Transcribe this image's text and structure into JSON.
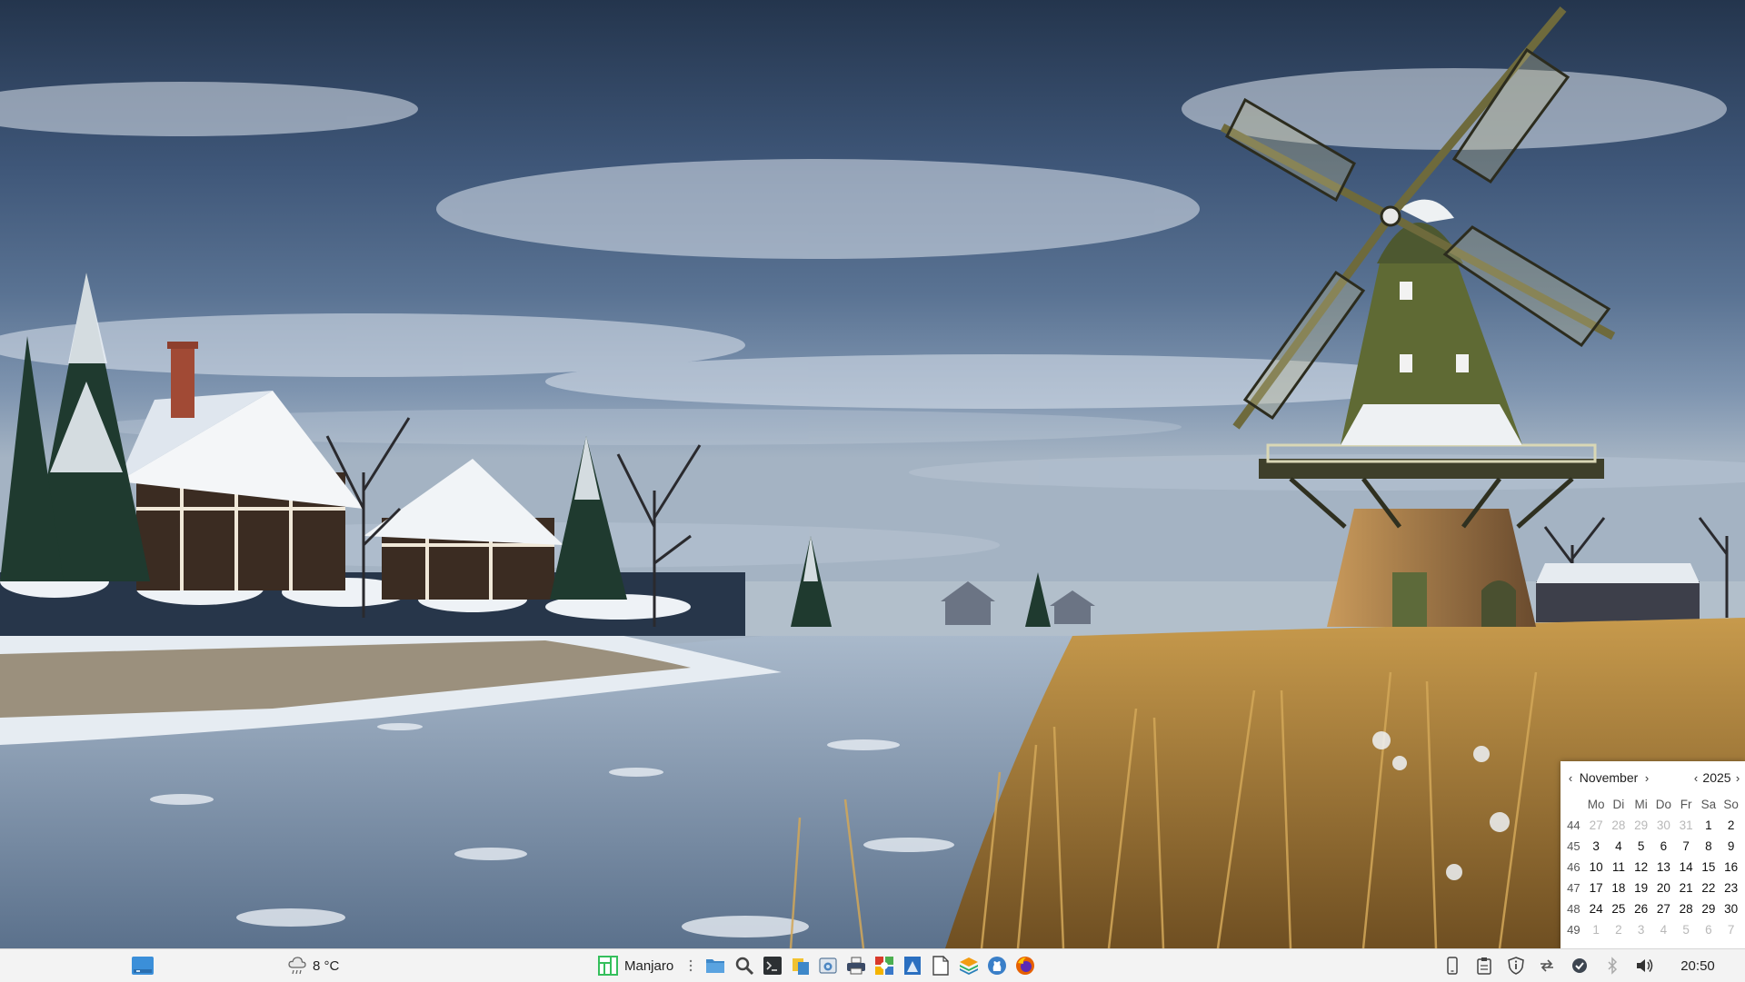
{
  "taskbar": {
    "weather": {
      "icon": "cloud-rain-icon",
      "temperature": "8 °C"
    },
    "menu": {
      "label": "Manjaro"
    },
    "clock": {
      "time": "20:50"
    }
  },
  "calendar": {
    "month": "November",
    "year": "2025",
    "weekdays": [
      "Mo",
      "Di",
      "Mi",
      "Do",
      "Fr",
      "Sa",
      "So"
    ],
    "weeks": [
      {
        "number": "44",
        "days": [
          [
            "27",
            false
          ],
          [
            "28",
            false
          ],
          [
            "29",
            false
          ],
          [
            "30",
            false
          ],
          [
            "31",
            false
          ],
          [
            "1",
            true
          ],
          [
            "2",
            true
          ]
        ]
      },
      {
        "number": "45",
        "days": [
          [
            "3",
            true
          ],
          [
            "4",
            true
          ],
          [
            "5",
            true
          ],
          [
            "6",
            true
          ],
          [
            "7",
            true
          ],
          [
            "8",
            true
          ],
          [
            "9",
            true
          ]
        ]
      },
      {
        "number": "46",
        "days": [
          [
            "10",
            true
          ],
          [
            "11",
            true
          ],
          [
            "12",
            true
          ],
          [
            "13",
            true
          ],
          [
            "14",
            true
          ],
          [
            "15",
            true
          ],
          [
            "16",
            true
          ]
        ]
      },
      {
        "number": "47",
        "days": [
          [
            "17",
            true
          ],
          [
            "18",
            true
          ],
          [
            "19",
            true
          ],
          [
            "20",
            true
          ],
          [
            "21",
            true
          ],
          [
            "22",
            true
          ],
          [
            "23",
            true
          ]
        ]
      },
      {
        "number": "48",
        "days": [
          [
            "24",
            true
          ],
          [
            "25",
            true
          ],
          [
            "26",
            true
          ],
          [
            "27",
            true
          ],
          [
            "28",
            true
          ],
          [
            "29",
            true
          ],
          [
            "30",
            true
          ]
        ]
      },
      {
        "number": "49",
        "days": [
          [
            "1",
            false
          ],
          [
            "2",
            false
          ],
          [
            "3",
            false
          ],
          [
            "4",
            false
          ],
          [
            "5",
            false
          ],
          [
            "6",
            false
          ],
          [
            "7",
            false
          ]
        ]
      }
    ]
  },
  "colors": {
    "taskbar_bg": "#f3f3f3",
    "manjaro_green": "#35bf5c",
    "sky_dark": "#2c3f5a",
    "ice": "#8aa2bb",
    "reeds": "#b98a3e"
  }
}
